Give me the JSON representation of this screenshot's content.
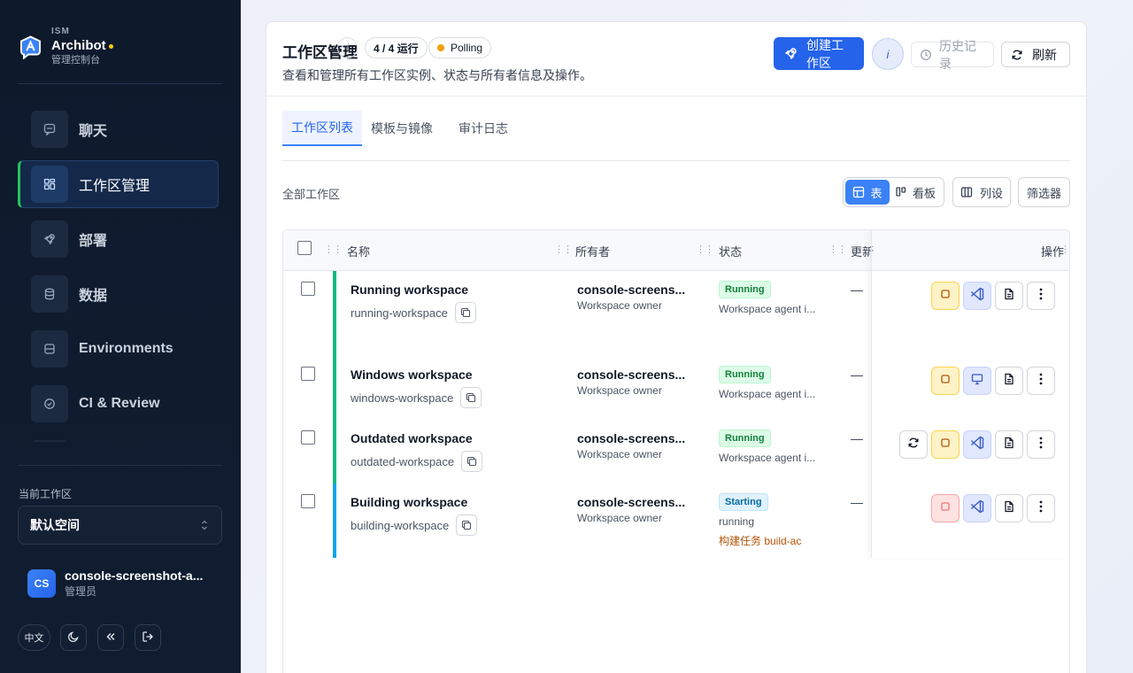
{
  "brand": {
    "org": "ISM",
    "name": "Archibot",
    "sub": "管理控制台"
  },
  "nav": [
    {
      "label": "聊天",
      "icon": "chat-icon",
      "active": false
    },
    {
      "label": "工作区管理",
      "icon": "grid-icon",
      "active": true
    },
    {
      "label": "部署",
      "icon": "rocket-icon",
      "active": false
    },
    {
      "label": "数据",
      "icon": "database-icon",
      "active": false
    },
    {
      "label": "Environments",
      "icon": "server-icon",
      "active": false
    },
    {
      "label": "CI & Review",
      "icon": "check-circle-icon",
      "active": false
    }
  ],
  "sidebar": {
    "workspace_label": "当前工作区",
    "workspace_value": "默认空间",
    "user_initials": "CS",
    "user_name": "console-screenshot-a...",
    "user_role": "管理员",
    "lang_label": "中文"
  },
  "header": {
    "title": "工作区管理",
    "info_badge": "i",
    "count_badge": "4 / 4 运行",
    "polling": "Polling",
    "subtitle": "查看和管理所有工作区实例、状态与所有者信息及操作。",
    "primary_button": "创建工作区",
    "circle_button": "i",
    "history_button": "历史记录",
    "refresh_button": "刷新"
  },
  "tabs": [
    {
      "label": "工作区列表",
      "active": true
    },
    {
      "label": "模板与镜像",
      "active": false
    },
    {
      "label": "审计日志",
      "active": false
    }
  ],
  "toolbar": {
    "list_label": "全部工作区",
    "view_table": "表",
    "view_board": "看板",
    "columns_button": "列设",
    "filter_button": "筛选器"
  },
  "columns": {
    "name": "名称",
    "owner": "所有者",
    "status": "状态",
    "extra": "更新",
    "actions": "操作"
  },
  "rows": [
    {
      "name": "Running workspace",
      "slug": "running-workspace",
      "owner": "console-screens...",
      "role": "Workspace owner",
      "status": "Running",
      "status_kind": "run",
      "detail": "Workspace agent i...",
      "build": "",
      "extra": "—",
      "bar": "#10b981",
      "actions": [
        "stop-icon",
        "vscode-icon",
        "file-icon",
        "more-icon"
      ]
    },
    {
      "name": "Windows workspace",
      "slug": "windows-workspace",
      "owner": "console-screens...",
      "role": "Workspace owner",
      "status": "Running",
      "status_kind": "run",
      "detail": "Workspace agent i...",
      "build": "",
      "extra": "—",
      "bar": "#10b981",
      "actions": [
        "stop-icon",
        "remote-desktop-icon",
        "file-icon",
        "more-icon"
      ]
    },
    {
      "name": "Outdated workspace",
      "slug": "outdated-workspace",
      "owner": "console-screens...",
      "role": "Workspace owner",
      "status": "Running",
      "status_kind": "run",
      "detail": "Workspace agent i...",
      "build": "",
      "extra": "—",
      "bar": "#10b981",
      "actions": [
        "update-icon",
        "stop-icon",
        "vscode-icon",
        "file-icon",
        "more-icon"
      ]
    },
    {
      "name": "Building workspace",
      "slug": "building-workspace",
      "owner": "console-screens...",
      "role": "Workspace owner",
      "status": "Starting",
      "status_kind": "start",
      "detail": "running",
      "build": "构建任务 build-ac",
      "extra": "—",
      "bar": "#0ea5e9",
      "actions": [
        "stop-icon",
        "vscode-icon",
        "file-icon",
        "more-icon"
      ]
    }
  ]
}
